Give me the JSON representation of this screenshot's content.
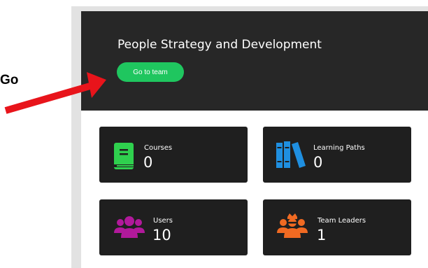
{
  "callout": {
    "text": "Go"
  },
  "header": {
    "title": "People Strategy and Development",
    "button_label": "Go to team"
  },
  "cards": [
    {
      "label": "Courses",
      "value": "0",
      "icon": "book-icon",
      "color": "#2fd04e"
    },
    {
      "label": "Learning Paths",
      "value": "0",
      "icon": "books-library-icon",
      "color": "#1f8fe0"
    },
    {
      "label": "Users",
      "value": "10",
      "icon": "users-group-icon",
      "color": "#b1199b"
    },
    {
      "label": "Team Leaders",
      "value": "1",
      "icon": "team-leaders-icon",
      "color": "#f06a22"
    }
  ],
  "colors": {
    "accent_button": "#1fc65f",
    "arrow": "#e8141b",
    "header_bg": "#272727",
    "card_bg": "#1f1f1f"
  }
}
